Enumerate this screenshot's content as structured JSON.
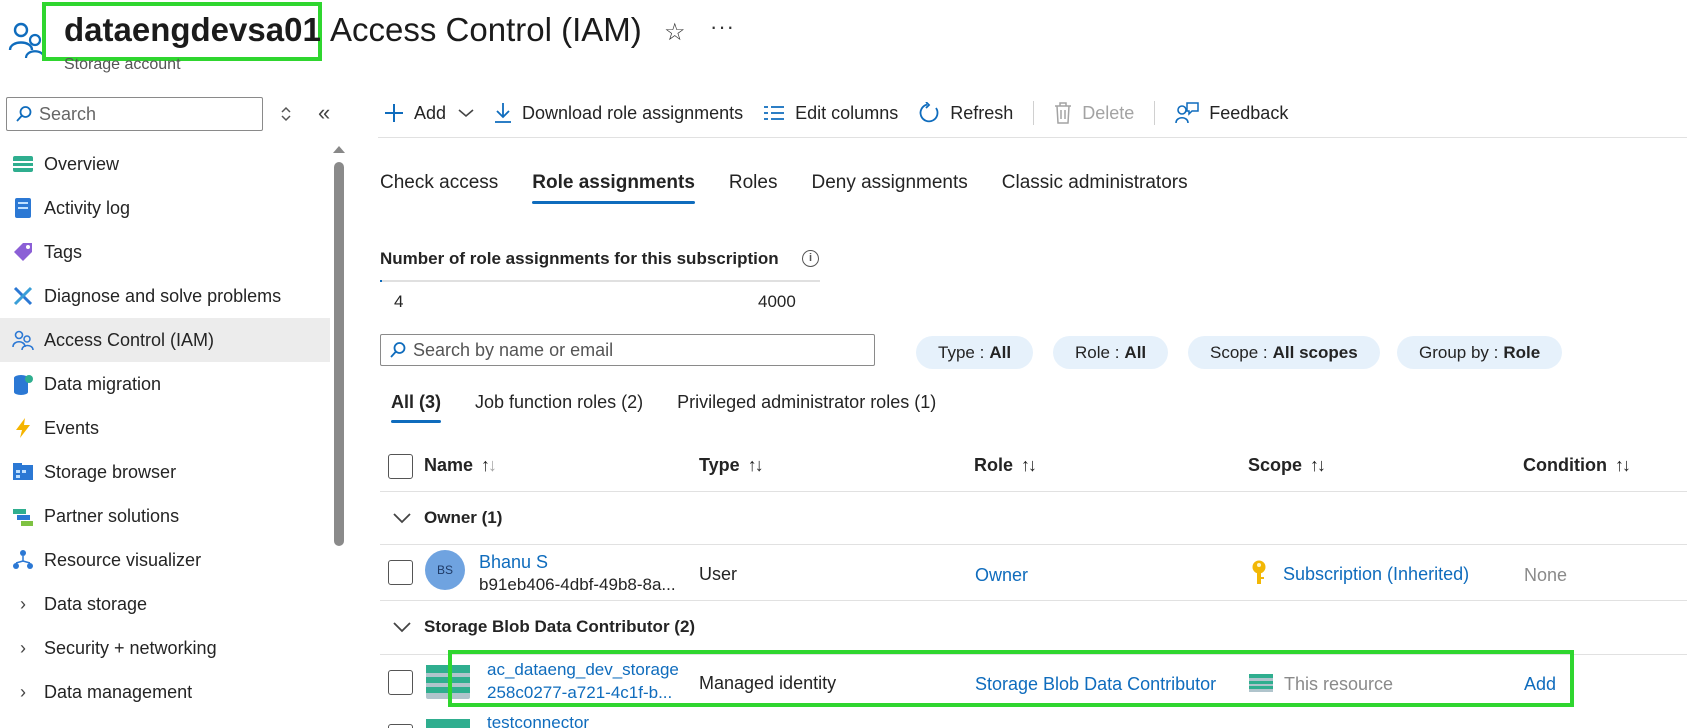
{
  "header": {
    "resource_name": "dataengdevsa01",
    "section_title": "Access Control (IAM)",
    "resource_type": "Storage account",
    "icons": [
      "iam-people-icon",
      "star-icon",
      "more-icon"
    ]
  },
  "sidebar": {
    "search_placeholder": "Search",
    "items": [
      {
        "label": "Overview",
        "icon": "overview-icon"
      },
      {
        "label": "Activity log",
        "icon": "activity-log-icon"
      },
      {
        "label": "Tags",
        "icon": "tag-icon"
      },
      {
        "label": "Diagnose and solve problems",
        "icon": "diagnose-icon"
      },
      {
        "label": "Access Control (IAM)",
        "icon": "iam-people-icon",
        "active": true
      },
      {
        "label": "Data migration",
        "icon": "data-migration-icon"
      },
      {
        "label": "Events",
        "icon": "events-bolt-icon"
      },
      {
        "label": "Storage browser",
        "icon": "storage-browser-icon"
      },
      {
        "label": "Partner solutions",
        "icon": "partner-solutions-icon"
      },
      {
        "label": "Resource visualizer",
        "icon": "resource-visualizer-icon"
      },
      {
        "label": "Data storage",
        "expandable": true
      },
      {
        "label": "Security + networking",
        "expandable": true
      },
      {
        "label": "Data management",
        "expandable": true
      }
    ]
  },
  "toolbar": {
    "add": "Add",
    "download": "Download role assignments",
    "edit_columns": "Edit columns",
    "refresh": "Refresh",
    "delete": "Delete",
    "feedback": "Feedback"
  },
  "tabs": [
    "Check access",
    "Role assignments",
    "Roles",
    "Deny assignments",
    "Classic administrators"
  ],
  "active_tab": "Role assignments",
  "count": {
    "label": "Number of role assignments for this subscription",
    "current": "4",
    "max": "4000",
    "fraction": 0.001
  },
  "search": {
    "placeholder": "Search by name or email"
  },
  "filters": [
    {
      "key": "Type",
      "value": "All"
    },
    {
      "key": "Role",
      "value": "All"
    },
    {
      "key": "Scope",
      "value": "All scopes"
    },
    {
      "key": "Group by",
      "value": "Role"
    }
  ],
  "subtabs": [
    "All (3)",
    "Job function roles (2)",
    "Privileged administrator roles (1)"
  ],
  "table": {
    "columns": [
      "Name",
      "Type",
      "Role",
      "Scope",
      "Condition"
    ],
    "groups": [
      {
        "label": "Owner (1)",
        "rows": [
          {
            "avatar": "BS",
            "name": "Bhanu S",
            "id": "b91eb406-4dbf-49b8-8a...",
            "type": "User",
            "role": "Owner",
            "scope": "Subscription (Inherited)",
            "scope_icon": "key-icon",
            "condition": "None"
          }
        ]
      },
      {
        "label": "Storage Blob Data Contributor (2)",
        "rows": [
          {
            "name": "ac_dataeng_dev_storage",
            "id": "258c0277-a721-4c1f-b...",
            "type": "Managed identity",
            "role": "Storage Blob Data Contributor",
            "scope": "This resource",
            "scope_icon": "storage-account-icon",
            "condition": "Add"
          },
          {
            "name": "testconnector"
          }
        ]
      }
    ]
  },
  "colors": {
    "accent": "#0f6cbd",
    "highlight": "#2fd62f"
  }
}
